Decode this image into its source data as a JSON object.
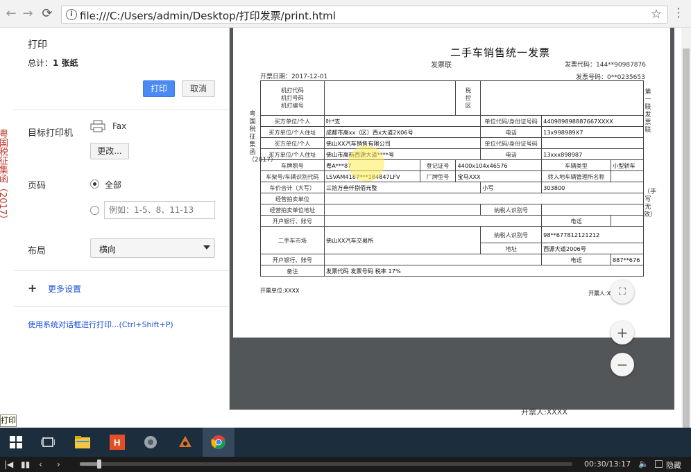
{
  "browser": {
    "url": "file:///C:/Users/admin/Desktop/打印发票/print.html",
    "back": "←",
    "forward": "→",
    "reload": "⟳",
    "info": "i",
    "star": "☆"
  },
  "left_stray": "粤国税征集函（2017）",
  "print_panel": {
    "title": "打印",
    "total_label": "总计：",
    "total_value": "1 张纸",
    "print_button": "打印",
    "cancel_button": "取消",
    "destination_label": "目标打印机",
    "printer_name": "Fax",
    "change_button": "更改...",
    "pages_label": "页码",
    "pages_all": "全部",
    "pages_placeholder": "例如：1-5、8、11-13",
    "layout_label": "布局",
    "layout_value": "横向",
    "more_settings": "更多设置",
    "system_dialog": "使用系统对话框进行打印...(Ctrl+Shift+P)"
  },
  "invoice": {
    "title": "二手车销售统一发票",
    "subtitle": "发票联",
    "code_label": "发票代码：144**90987876",
    "date_label": "开票日期：2017-12-01",
    "number_label": "发票号码：0**0235653",
    "vert_left": "粤国税征集函（2017）",
    "vert_right_top": "第一联发票联",
    "vert_right_bottom": "（手写无效）",
    "machine_codes": "机打代码\n机打号码\n机打编号",
    "tax_area": "税\n控\n区",
    "rows": {
      "buyer": "买方单位/个人",
      "buyer_name": "叶*支",
      "buyer_id_label": "单位代码/身份证号码",
      "buyer_id": "440989898887667XXXX",
      "buyer_addr_label": "买方单位/个人住址",
      "buyer_addr": "成都市高xx（区）西x大道2X06号",
      "phone_label": "电话",
      "buyer_phone": "13x998989X7",
      "seller": "买方单位/个人",
      "seller_name": "佛山XX汽车销售有限公司",
      "seller_id_label": "单位代码/身份证号码",
      "seller_addr_label": "买方单位/个人住址",
      "seller_addr": "佛山市高新西源大道****号",
      "seller_phone": "13xxx898987",
      "plate_label": "车牌照号",
      "plate": "粤A***87",
      "reg_label": "登记证号",
      "reg": "4400x104x46576",
      "type_label": "车辆类型",
      "type": "小型轿车",
      "vin_label": "车架号/车辆识别代码",
      "vin": "LSVAM4187***184847LFV",
      "model_label": "厂牌型号",
      "model": "宝马XXX",
      "transfer_label": "转入地车辆管理所名称",
      "total_label": "车价合计（大写）",
      "total_cn": "三拾万叁仟捌佰元整",
      "small_label": "小写",
      "total_num": "303800",
      "auction_label": "经营拍卖单位",
      "auction_addr_label": "经营拍卖单位地址",
      "taxpayer_label": "纳税人识别号",
      "bank_label": "开户银行、账号",
      "market_label": "二手车市场",
      "market_name": "佛山XX汽车交易所",
      "market_taxid": "98**677812121212",
      "addr_label": "地址",
      "market_addr": "西源大道2006号",
      "market_phone": "887**676",
      "remark_label": "备注",
      "remark": "发票代码 发票号码 税率 17%"
    },
    "seller_sign": "开票单位:XXXX",
    "payee_sign": "开票人:X"
  },
  "bg_text": "开票人:XXXX",
  "tooltip": "打印",
  "zoom": {
    "fit": "⛶",
    "in": "+",
    "out": "−"
  },
  "player": {
    "time": "00:30/13:17",
    "hide": "隐藏",
    "progress": 0.04
  }
}
